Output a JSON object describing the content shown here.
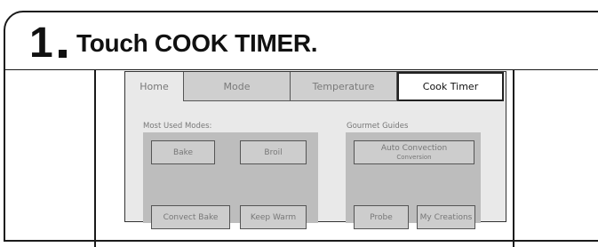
{
  "step": {
    "number": "1",
    "title": "Touch COOK TIMER."
  },
  "tabs": [
    {
      "label": "Home"
    },
    {
      "label": "Mode"
    },
    {
      "label": "Temperature"
    },
    {
      "label": "Cook Timer"
    }
  ],
  "most_used": {
    "heading": "Most Used Modes:",
    "buttons": [
      "Bake",
      "Broil",
      "Convect Bake",
      "Keep Warm"
    ]
  },
  "gourmet": {
    "heading": "Gourmet Guides",
    "auto_convection": {
      "line1": "Auto Convection",
      "line2": "Conversion"
    },
    "buttons": [
      "Probe",
      "My Creations"
    ]
  }
}
